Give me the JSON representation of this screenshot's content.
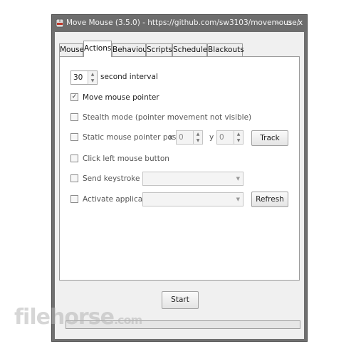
{
  "window": {
    "title": "Move Mouse (3.5.0) - https://github.com/sw3103/movemouse/",
    "minimize": "–",
    "maximize": "▫",
    "close": "x"
  },
  "tabs": [
    {
      "label": "Mouse",
      "active": false
    },
    {
      "label": "Actions",
      "active": true
    },
    {
      "label": "Behaviour",
      "active": false
    },
    {
      "label": "Scripts",
      "active": false
    },
    {
      "label": "Schedules",
      "active": false
    },
    {
      "label": "Blackouts",
      "active": false
    }
  ],
  "actions": {
    "interval_value": "30",
    "interval_label": "second interval",
    "move_pointer": {
      "label": "Move mouse pointer",
      "checked": true
    },
    "stealth_mode": {
      "label": "Stealth mode (pointer movement not visible)",
      "checked": false
    },
    "static_position": {
      "label": "Static mouse pointer position",
      "checked": false,
      "x_label": "x",
      "x_value": "0",
      "y_label": "y",
      "y_value": "0"
    },
    "track_button": "Track",
    "click_left": {
      "label": "Click left mouse button",
      "checked": false
    },
    "send_keystroke": {
      "label": "Send keystroke",
      "checked": false,
      "value": ""
    },
    "activate_app": {
      "label": "Activate application",
      "checked": false,
      "value": ""
    },
    "refresh_button": "Refresh"
  },
  "start_button": "Start",
  "progress": 0.0,
  "watermark": {
    "main": "filehorse",
    "suffix": ".com"
  },
  "colors": {
    "titlebar": "#6d6d6d",
    "panel": "#ffffff",
    "client": "#f0f0f0"
  }
}
